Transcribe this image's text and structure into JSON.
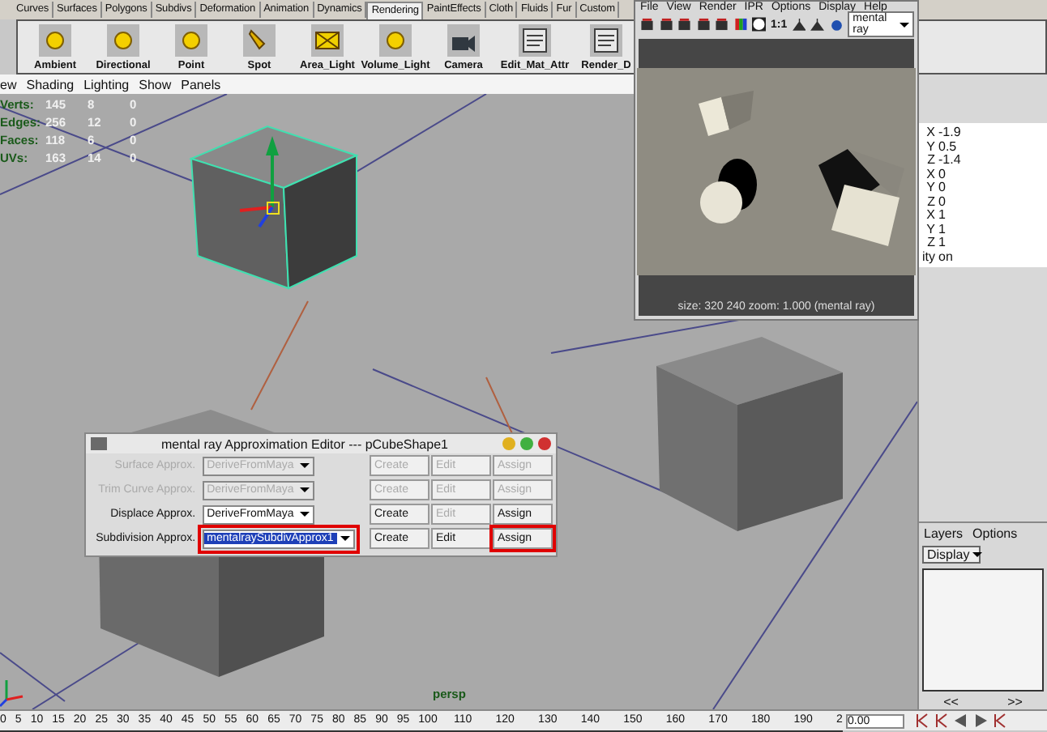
{
  "shelf_tabs": [
    {
      "label": "Curves",
      "selected": false
    },
    {
      "label": "Surfaces",
      "selected": false
    },
    {
      "label": "Polygons",
      "selected": false
    },
    {
      "label": "Subdivs",
      "selected": false
    },
    {
      "label": "Deformation",
      "selected": false
    },
    {
      "label": "Animation",
      "selected": false
    },
    {
      "label": "Dynamics",
      "selected": false
    },
    {
      "label": "Rendering",
      "selected": true
    },
    {
      "label": "PaintEffects",
      "selected": false
    },
    {
      "label": "Cloth",
      "selected": false
    },
    {
      "label": "Fluids",
      "selected": false
    },
    {
      "label": "Fur",
      "selected": false
    },
    {
      "label": "Custom",
      "selected": false
    }
  ],
  "shelf_buttons": [
    {
      "label": "Ambient"
    },
    {
      "label": "Directional"
    },
    {
      "label": "Point"
    },
    {
      "label": "Spot"
    },
    {
      "label": "Area_Light"
    },
    {
      "label": "Volume_Light"
    },
    {
      "label": "Camera"
    },
    {
      "label": "Edit_Mat_Attr"
    },
    {
      "label": "Render_D"
    }
  ],
  "viewport": {
    "menu": [
      "ew",
      "Shading",
      "Lighting",
      "Show",
      "Panels"
    ],
    "hud": [
      {
        "label": "Verts:",
        "values": [
          "145",
          "8",
          "0"
        ]
      },
      {
        "label": "Edges:",
        "values": [
          "256",
          "12",
          "0"
        ]
      },
      {
        "label": "Faces:",
        "values": [
          "118",
          "6",
          "0"
        ]
      },
      {
        "label": "UVs:",
        "values": [
          "163",
          "14",
          "0"
        ]
      }
    ],
    "camera_label": "persp"
  },
  "render_view": {
    "menu": [
      "File",
      "View",
      "Render",
      "IPR",
      "Options",
      "Display",
      "Help"
    ],
    "zoom_button": "1:1",
    "renderer": "mental ray",
    "status": "size: 320 240 zoom: 1.000 (mental ray)"
  },
  "channel_box": {
    "rows": [
      {
        "axis": "X",
        "value": "-1.9"
      },
      {
        "axis": "Y",
        "value": "0.5"
      },
      {
        "axis": "Z",
        "value": "-1.4"
      },
      {
        "axis": "X",
        "value": "0"
      },
      {
        "axis": "Y",
        "value": "0"
      },
      {
        "axis": "Z",
        "value": "0"
      },
      {
        "axis": "X",
        "value": "1"
      },
      {
        "axis": "Y",
        "value": "1"
      },
      {
        "axis": "Z",
        "value": "1"
      },
      {
        "axis": "ity",
        "value": "on"
      }
    ]
  },
  "layers": {
    "menu": [
      "Layers",
      "Options"
    ],
    "dropdown": "Display",
    "scroll_left": "<<",
    "scroll_right": ">>"
  },
  "approx_editor": {
    "title": "mental ray Approximation Editor --- pCubeShape1",
    "rows": [
      {
        "label": "Surface Approx.",
        "value": "DeriveFromMaya",
        "disabled": true,
        "highlighted": false,
        "buttons": [
          {
            "label": "Create",
            "disabled": true,
            "highlighted": false
          },
          {
            "label": "Edit",
            "disabled": true,
            "highlighted": false
          },
          {
            "label": "Assign",
            "disabled": true,
            "highlighted": false
          }
        ]
      },
      {
        "label": "Trim Curve Approx.",
        "value": "DeriveFromMaya",
        "disabled": true,
        "highlighted": false,
        "buttons": [
          {
            "label": "Create",
            "disabled": true,
            "highlighted": false
          },
          {
            "label": "Edit",
            "disabled": true,
            "highlighted": false
          },
          {
            "label": "Assign",
            "disabled": true,
            "highlighted": false
          }
        ]
      },
      {
        "label": "Displace Approx.",
        "value": "DeriveFromMaya",
        "disabled": false,
        "highlighted": false,
        "buttons": [
          {
            "label": "Create",
            "disabled": false,
            "highlighted": false
          },
          {
            "label": "Edit",
            "disabled": true,
            "highlighted": false
          },
          {
            "label": "Assign",
            "disabled": false,
            "highlighted": false
          }
        ]
      },
      {
        "label": "Subdivision Approx.",
        "value": "mentalraySubdivApprox1",
        "disabled": false,
        "highlighted": true,
        "buttons": [
          {
            "label": "Create",
            "disabled": false,
            "highlighted": false
          },
          {
            "label": "Edit",
            "disabled": false,
            "highlighted": false
          },
          {
            "label": "Assign",
            "disabled": false,
            "highlighted": true
          }
        ]
      }
    ]
  },
  "timeline": {
    "ticks_by_5": [
      "0",
      "5",
      "10",
      "15",
      "20",
      "25",
      "30",
      "35",
      "40",
      "45",
      "50",
      "55",
      "60",
      "65",
      "70",
      "75",
      "80",
      "85",
      "90",
      "95",
      "100"
    ],
    "ticks_by_10": [
      "110",
      "120",
      "130",
      "140",
      "150",
      "160",
      "170",
      "180",
      "190",
      "2"
    ],
    "current_frame": "0.00"
  }
}
